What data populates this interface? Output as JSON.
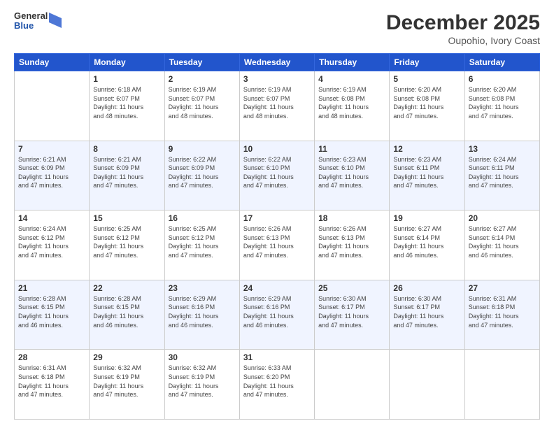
{
  "header": {
    "logo_general": "General",
    "logo_blue": "Blue",
    "month": "December 2025",
    "location": "Oupohio, Ivory Coast"
  },
  "days_of_week": [
    "Sunday",
    "Monday",
    "Tuesday",
    "Wednesday",
    "Thursday",
    "Friday",
    "Saturday"
  ],
  "weeks": [
    [
      {
        "day": "",
        "info": ""
      },
      {
        "day": "1",
        "info": "Sunrise: 6:18 AM\nSunset: 6:07 PM\nDaylight: 11 hours\nand 48 minutes."
      },
      {
        "day": "2",
        "info": "Sunrise: 6:19 AM\nSunset: 6:07 PM\nDaylight: 11 hours\nand 48 minutes."
      },
      {
        "day": "3",
        "info": "Sunrise: 6:19 AM\nSunset: 6:07 PM\nDaylight: 11 hours\nand 48 minutes."
      },
      {
        "day": "4",
        "info": "Sunrise: 6:19 AM\nSunset: 6:08 PM\nDaylight: 11 hours\nand 48 minutes."
      },
      {
        "day": "5",
        "info": "Sunrise: 6:20 AM\nSunset: 6:08 PM\nDaylight: 11 hours\nand 47 minutes."
      },
      {
        "day": "6",
        "info": "Sunrise: 6:20 AM\nSunset: 6:08 PM\nDaylight: 11 hours\nand 47 minutes."
      }
    ],
    [
      {
        "day": "7",
        "info": "Sunrise: 6:21 AM\nSunset: 6:09 PM\nDaylight: 11 hours\nand 47 minutes."
      },
      {
        "day": "8",
        "info": "Sunrise: 6:21 AM\nSunset: 6:09 PM\nDaylight: 11 hours\nand 47 minutes."
      },
      {
        "day": "9",
        "info": "Sunrise: 6:22 AM\nSunset: 6:09 PM\nDaylight: 11 hours\nand 47 minutes."
      },
      {
        "day": "10",
        "info": "Sunrise: 6:22 AM\nSunset: 6:10 PM\nDaylight: 11 hours\nand 47 minutes."
      },
      {
        "day": "11",
        "info": "Sunrise: 6:23 AM\nSunset: 6:10 PM\nDaylight: 11 hours\nand 47 minutes."
      },
      {
        "day": "12",
        "info": "Sunrise: 6:23 AM\nSunset: 6:11 PM\nDaylight: 11 hours\nand 47 minutes."
      },
      {
        "day": "13",
        "info": "Sunrise: 6:24 AM\nSunset: 6:11 PM\nDaylight: 11 hours\nand 47 minutes."
      }
    ],
    [
      {
        "day": "14",
        "info": "Sunrise: 6:24 AM\nSunset: 6:12 PM\nDaylight: 11 hours\nand 47 minutes."
      },
      {
        "day": "15",
        "info": "Sunrise: 6:25 AM\nSunset: 6:12 PM\nDaylight: 11 hours\nand 47 minutes."
      },
      {
        "day": "16",
        "info": "Sunrise: 6:25 AM\nSunset: 6:12 PM\nDaylight: 11 hours\nand 47 minutes."
      },
      {
        "day": "17",
        "info": "Sunrise: 6:26 AM\nSunset: 6:13 PM\nDaylight: 11 hours\nand 47 minutes."
      },
      {
        "day": "18",
        "info": "Sunrise: 6:26 AM\nSunset: 6:13 PM\nDaylight: 11 hours\nand 47 minutes."
      },
      {
        "day": "19",
        "info": "Sunrise: 6:27 AM\nSunset: 6:14 PM\nDaylight: 11 hours\nand 46 minutes."
      },
      {
        "day": "20",
        "info": "Sunrise: 6:27 AM\nSunset: 6:14 PM\nDaylight: 11 hours\nand 46 minutes."
      }
    ],
    [
      {
        "day": "21",
        "info": "Sunrise: 6:28 AM\nSunset: 6:15 PM\nDaylight: 11 hours\nand 46 minutes."
      },
      {
        "day": "22",
        "info": "Sunrise: 6:28 AM\nSunset: 6:15 PM\nDaylight: 11 hours\nand 46 minutes."
      },
      {
        "day": "23",
        "info": "Sunrise: 6:29 AM\nSunset: 6:16 PM\nDaylight: 11 hours\nand 46 minutes."
      },
      {
        "day": "24",
        "info": "Sunrise: 6:29 AM\nSunset: 6:16 PM\nDaylight: 11 hours\nand 46 minutes."
      },
      {
        "day": "25",
        "info": "Sunrise: 6:30 AM\nSunset: 6:17 PM\nDaylight: 11 hours\nand 47 minutes."
      },
      {
        "day": "26",
        "info": "Sunrise: 6:30 AM\nSunset: 6:17 PM\nDaylight: 11 hours\nand 47 minutes."
      },
      {
        "day": "27",
        "info": "Sunrise: 6:31 AM\nSunset: 6:18 PM\nDaylight: 11 hours\nand 47 minutes."
      }
    ],
    [
      {
        "day": "28",
        "info": "Sunrise: 6:31 AM\nSunset: 6:18 PM\nDaylight: 11 hours\nand 47 minutes."
      },
      {
        "day": "29",
        "info": "Sunrise: 6:32 AM\nSunset: 6:19 PM\nDaylight: 11 hours\nand 47 minutes."
      },
      {
        "day": "30",
        "info": "Sunrise: 6:32 AM\nSunset: 6:19 PM\nDaylight: 11 hours\nand 47 minutes."
      },
      {
        "day": "31",
        "info": "Sunrise: 6:33 AM\nSunset: 6:20 PM\nDaylight: 11 hours\nand 47 minutes."
      },
      {
        "day": "",
        "info": ""
      },
      {
        "day": "",
        "info": ""
      },
      {
        "day": "",
        "info": ""
      }
    ]
  ]
}
